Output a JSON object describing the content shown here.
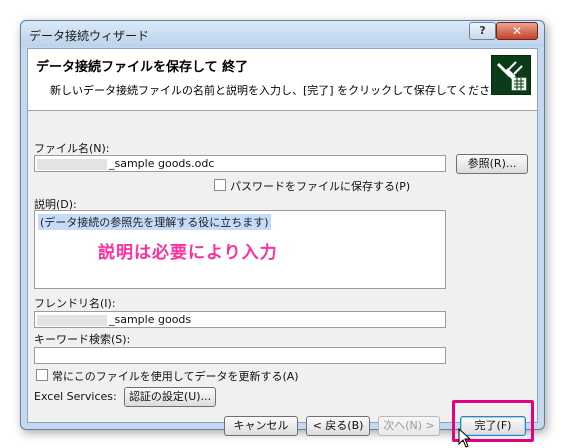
{
  "window": {
    "title": "データ接続ウィザード",
    "help_label": "?",
    "close_label": "✕"
  },
  "header": {
    "title": "データ接続ファイルを保存して 終了",
    "subtitle": "新しいデータ接続ファイルの名前と説明を入力し、[完了] をクリックして保存してください。",
    "icon": "data-connection-plug-icon"
  },
  "file_name": {
    "label": "ファイル名(N):",
    "value": "_sample goods.odc",
    "browse_label": "参照(R)..."
  },
  "save_password": {
    "label": "パスワードをファイルに保存する(P)",
    "checked": false
  },
  "description": {
    "label": "説明(D):",
    "value": "(データ接続の参照先を理解する役に立ちます)"
  },
  "annotation": {
    "text": "説明は必要により入力",
    "color": "#ff2fa0"
  },
  "friendly_name": {
    "label": "フレンドリ名(I):",
    "value": "_sample goods"
  },
  "keywords": {
    "label": "キーワード検索(S):",
    "value": ""
  },
  "always_use": {
    "label": "常にこのファイルを使用してデータを更新する(A)",
    "checked": false
  },
  "excel_services": {
    "label": "Excel Services:",
    "auth_label": "認証の設定(U)..."
  },
  "footer": {
    "cancel_label": "キャンセル",
    "back_label": "< 戻る(B)",
    "next_label": "次へ(N) >",
    "finish_label": "完了(F)"
  },
  "colors": {
    "highlight": "#e5007e",
    "annotation": "#ff2fa0",
    "window_frame": "#c4d9ee"
  }
}
